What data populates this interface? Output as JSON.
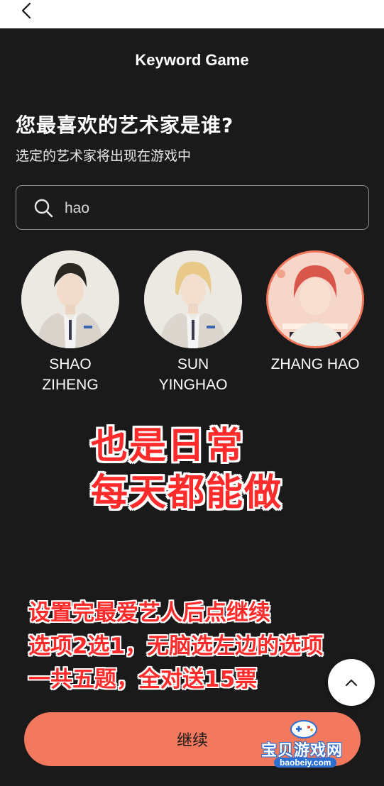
{
  "header": {
    "title": "Keyword Game"
  },
  "prompt": {
    "question": "您最喜欢的艺术家是谁?",
    "subtitle": "选定的艺术家将出现在游戏中"
  },
  "search": {
    "value": "hao",
    "icon": "search-icon"
  },
  "artists": [
    {
      "name": "SHAO\nZIHENG",
      "selected": false
    },
    {
      "name": "SUN\nYINGHAO",
      "selected": false
    },
    {
      "name": "ZHANG HAO",
      "selected": true
    }
  ],
  "overlay": {
    "big_line1": "也是日常",
    "big_line2": "每天都能做",
    "tip_line1": "设置完最爱艺人后点继续",
    "tip_line2": "选项2选1，无脑选左边的选项",
    "tip_line3": "一共五题，全对送15票"
  },
  "footer": {
    "continue_label": "继续"
  },
  "watermark": {
    "brand": "宝贝游戏网",
    "url": "baobeiy.com"
  },
  "colors": {
    "accent": "#f2785e",
    "background": "#1a1a1a",
    "overlay_text": "#ff2a2a"
  }
}
